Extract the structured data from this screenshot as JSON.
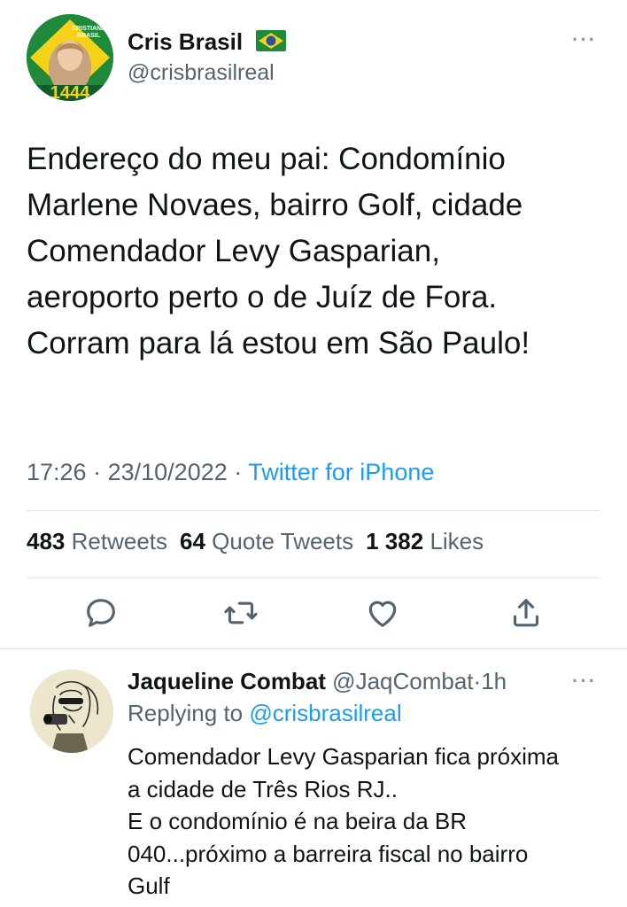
{
  "main_tweet": {
    "author": {
      "name": "Cris Brasil",
      "handle": "@crisbrasilreal",
      "avatar_badge_top": "CRISTIANE",
      "avatar_badge_bottom": "BRASIL",
      "avatar_number": "1444",
      "flag_icon": "brazil-flag-icon"
    },
    "more_label": "···",
    "text": "Endereço do meu pai: Condomínio\nMarlene Novaes, bairro Golf, cidade\nComendador Levy Gasparian,\naeroporto perto o de Juíz de Fora.\nCorram para lá estou em São Paulo!",
    "time": "17:26",
    "separator": "·",
    "date": "23/10/2022",
    "source": "Twitter for iPhone",
    "stats": {
      "retweets_count": "483",
      "retweets_label": "Retweets",
      "quotes_count": "64",
      "quotes_label": "Quote Tweets",
      "likes_count": "1 382",
      "likes_label": "Likes"
    },
    "actions": [
      "reply-icon",
      "retweet-icon",
      "like-icon",
      "share-icon"
    ]
  },
  "reply": {
    "name": "Jaqueline Combat",
    "handle": "@JaqCombat",
    "separator": "·",
    "time": "1h",
    "more_label": "···",
    "replying_prefix": "Replying to",
    "replying_to": "@crisbrasilreal",
    "text": "Comendador Levy Gasparian fica próxima\na cidade de Três Rios RJ..\nE o condomínio é na beira da BR\n040...próximo a barreira fiscal no bairro\nGulf"
  },
  "colors": {
    "accent": "#1d9bf0",
    "muted": "#536471",
    "text": "#0f1419",
    "divider": "#e1e5e8"
  }
}
